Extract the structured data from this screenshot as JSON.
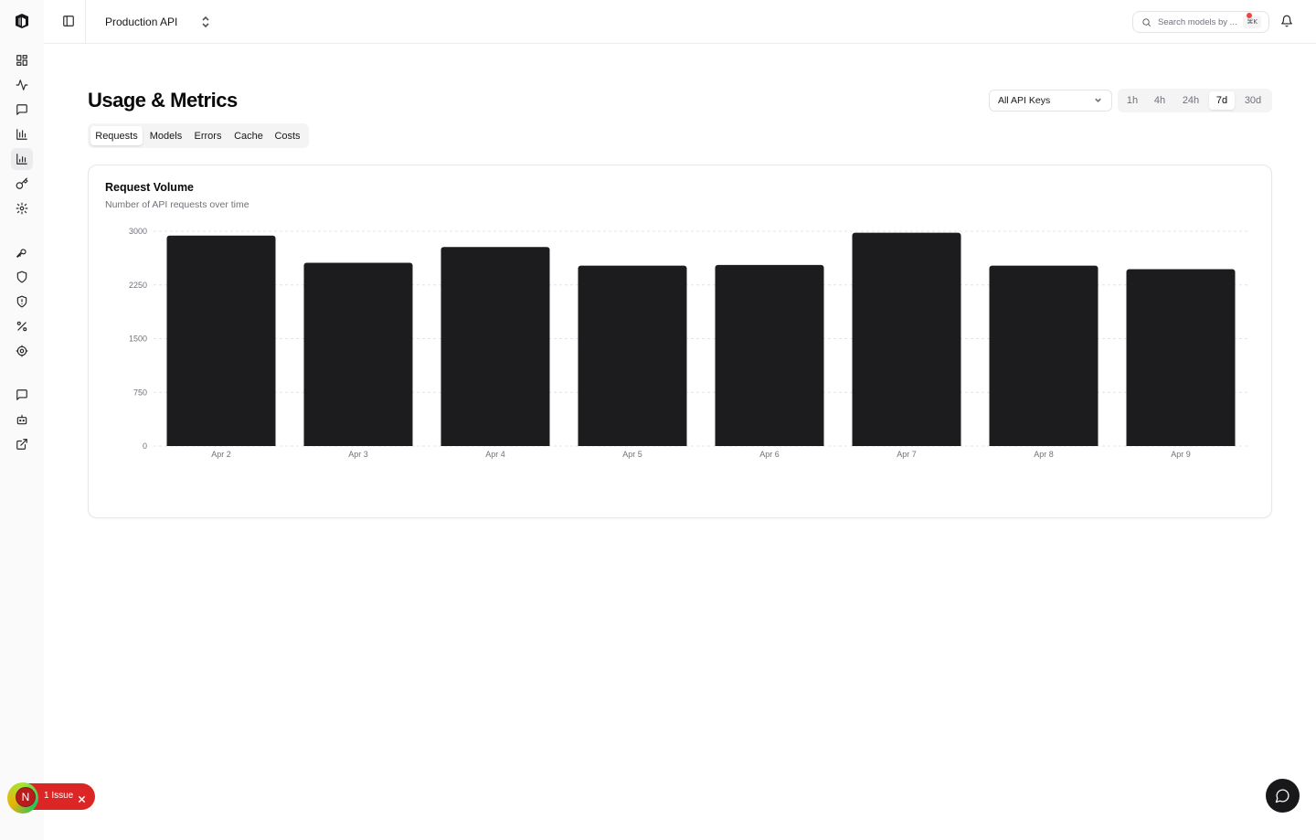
{
  "topbar": {
    "project": "Production API",
    "search_placeholder": "Search models by ...",
    "search_shortcut": "⌘K"
  },
  "sidebar": {
    "icons": [
      "dashboard-icon",
      "activity-icon",
      "message-square-icon",
      "bar-chart-icon",
      "analytics-icon",
      "key-icon",
      "settings-icon",
      "wrench-key-icon",
      "shield-icon",
      "shield-alert-icon",
      "percent-icon",
      "cog-icon",
      "feedback-icon",
      "bot-icon",
      "external-link-icon"
    ],
    "active_icon": "analytics-icon"
  },
  "page": {
    "title": "Usage & Metrics",
    "api_key_filter": "All API Keys",
    "ranges": [
      "1h",
      "4h",
      "24h",
      "7d",
      "30d"
    ],
    "active_range": "7d",
    "tabs": [
      "Requests",
      "Models",
      "Errors",
      "Cache",
      "Costs"
    ],
    "active_tab": "Requests"
  },
  "card": {
    "title": "Request Volume",
    "subtitle": "Number of API requests over time"
  },
  "chart_data": {
    "type": "bar",
    "categories": [
      "Apr 2",
      "Apr 3",
      "Apr 4",
      "Apr 5",
      "Apr 6",
      "Apr 7",
      "Apr 8",
      "Apr 9"
    ],
    "values": [
      2940,
      2560,
      2780,
      2520,
      2530,
      2980,
      2520,
      2470
    ],
    "yticks": [
      "3000",
      "2250",
      "1500",
      "750",
      "0"
    ],
    "ylim": [
      0,
      3000
    ],
    "grid": true,
    "bar_color": "#1c1c1e"
  },
  "issue_badge": {
    "avatar_letter": "N",
    "label": "1 Issue"
  },
  "colors": {
    "accent": "#18181b",
    "issue": "#dc2626",
    "notification_dot": "#ef4444"
  }
}
